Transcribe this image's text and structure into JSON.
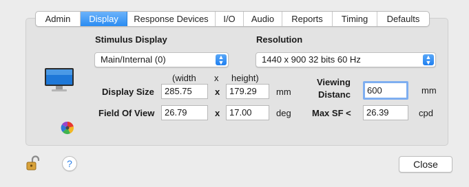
{
  "tabs": [
    {
      "label": "Admin"
    },
    {
      "label": "Display"
    },
    {
      "label": "Response Devices"
    },
    {
      "label": "I/O"
    },
    {
      "label": "Audio"
    },
    {
      "label": "Reports"
    },
    {
      "label": "Timing"
    },
    {
      "label": "Defaults"
    }
  ],
  "stimulus_display": {
    "heading": "Stimulus Display",
    "selected": "Main/Internal (0)"
  },
  "resolution": {
    "heading": "Resolution",
    "selected": "1440 x 900  32 bits  60 Hz"
  },
  "columns": {
    "width": "(width",
    "x": "x",
    "height": "height)"
  },
  "display_size": {
    "label": "Display Size",
    "width": "285.75",
    "x": "x",
    "height": "179.29",
    "unit": "mm"
  },
  "field_of_view": {
    "label": "Field Of View",
    "width": "26.79",
    "x": "x",
    "height": "17.00",
    "unit": "deg"
  },
  "viewing_distance": {
    "label_line1": "Viewing",
    "label_line2": "Distanc",
    "value": "600",
    "unit": "mm"
  },
  "max_sf": {
    "label": "Max SF <",
    "value": "26.39",
    "unit": "cpd"
  },
  "footer": {
    "help": "?",
    "close": "Close"
  },
  "colors": {
    "accent": "#2a8cf2",
    "focus_ring": "#7eaef0"
  },
  "icons": [
    "monitor-icon",
    "color-wheel-icon",
    "lock-icon",
    "help-icon",
    "chevron-updown-icon"
  ]
}
